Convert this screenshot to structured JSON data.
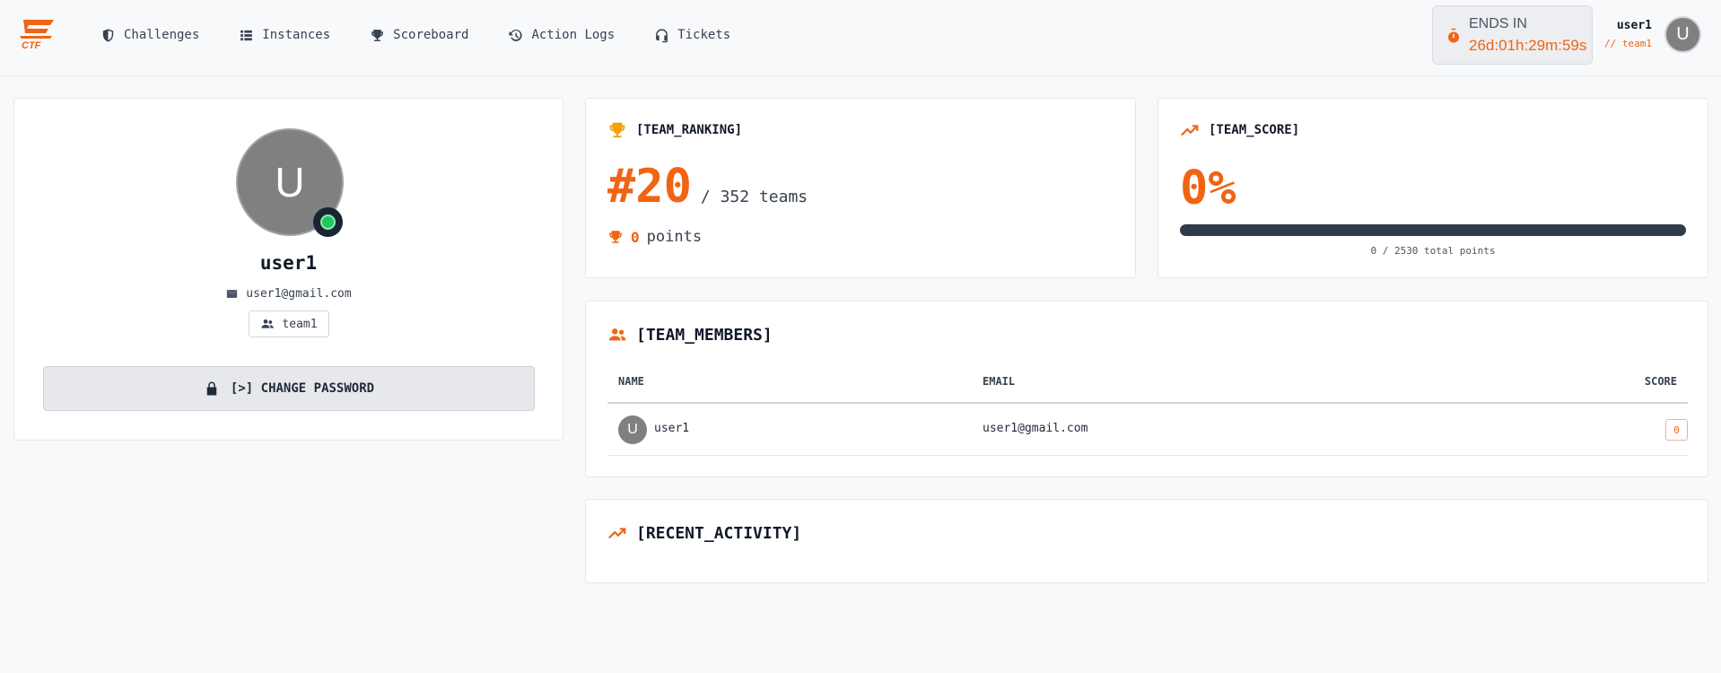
{
  "header": {
    "nav": [
      {
        "label": "Challenges",
        "icon": "shield-icon"
      },
      {
        "label": "Instances",
        "icon": "list-icon"
      },
      {
        "label": "Scoreboard",
        "icon": "trophy-icon"
      },
      {
        "label": "Action Logs",
        "icon": "history-icon"
      },
      {
        "label": "Tickets",
        "icon": "headset-icon"
      }
    ],
    "timer": {
      "label": "ENDS IN",
      "value": "26d:01h:29m:59s"
    },
    "user": {
      "name": "user1",
      "team": "// team1",
      "avatar": "U"
    }
  },
  "profile": {
    "avatar": "U",
    "name": "user1",
    "email": "user1@gmail.com",
    "team": "team1",
    "change_password": "[>] CHANGE PASSWORD"
  },
  "ranking": {
    "title": "[TEAM_RANKING]",
    "rank": "#20",
    "total": "/ 352 teams",
    "points_value": "0",
    "points_label": "points"
  },
  "score": {
    "title": "[TEAM_SCORE]",
    "percent": "0%",
    "progress_fraction": 0,
    "total": "0 / 2530 total points"
  },
  "members": {
    "title": "[TEAM_MEMBERS]",
    "columns": {
      "name": "NAME",
      "email": "EMAIL",
      "score": "SCORE"
    },
    "rows": [
      {
        "avatar": "U",
        "name": "user1",
        "email": "user1@gmail.com",
        "score": "0"
      }
    ]
  },
  "activity": {
    "title": "[RECENT_ACTIVITY]"
  },
  "colors": {
    "accent": "#f06414",
    "trophy": "#f5a000",
    "online": "#22c55e"
  }
}
